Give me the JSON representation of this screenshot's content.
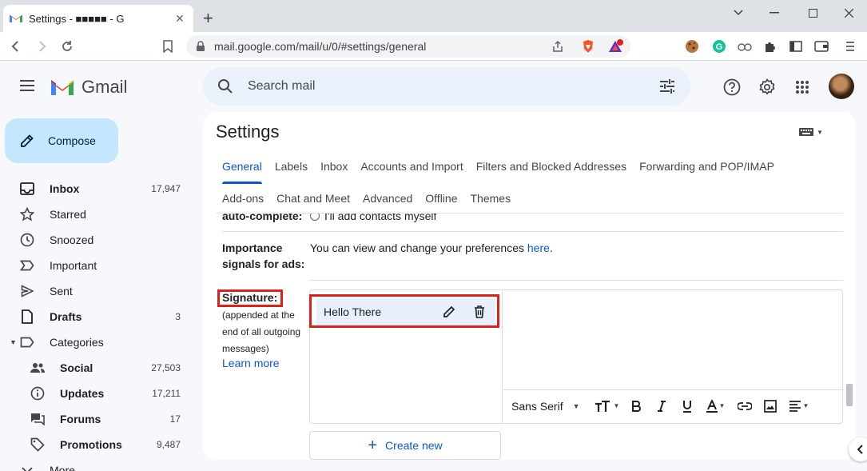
{
  "browser": {
    "tab_title": "Settings - ■■■■■ - G",
    "url": "mail.google.com/mail/u/0/#settings/general",
    "extension_badge": "10"
  },
  "header": {
    "logo_text": "Gmail",
    "search_placeholder": "Search mail"
  },
  "sidebar": {
    "compose_label": "Compose",
    "items": [
      {
        "label": "Inbox",
        "count": "17,947",
        "icon": "inbox-icon"
      },
      {
        "label": "Starred",
        "count": "",
        "icon": "star-icon"
      },
      {
        "label": "Snoozed",
        "count": "",
        "icon": "clock-icon"
      },
      {
        "label": "Important",
        "count": "",
        "icon": "important-icon"
      },
      {
        "label": "Sent",
        "count": "",
        "icon": "send-icon"
      },
      {
        "label": "Drafts",
        "count": "3",
        "icon": "draft-icon"
      },
      {
        "label": "Categories",
        "count": "",
        "icon": "label-icon"
      },
      {
        "label": "Social",
        "count": "27,503",
        "icon": "people-icon"
      },
      {
        "label": "Updates",
        "count": "17,211",
        "icon": "info-icon"
      },
      {
        "label": "Forums",
        "count": "17",
        "icon": "forum-icon"
      },
      {
        "label": "Promotions",
        "count": "9,487",
        "icon": "tag-icon"
      },
      {
        "label": "More",
        "count": "",
        "icon": "chevron-down-icon"
      }
    ]
  },
  "settings": {
    "title": "Settings",
    "tabs_row1": [
      "General",
      "Labels",
      "Inbox",
      "Accounts and Import",
      "Filters and Blocked Addresses",
      "Forwarding and POP/IMAP"
    ],
    "tabs_row2": [
      "Add-ons",
      "Chat and Meet",
      "Advanced",
      "Offline",
      "Themes"
    ],
    "autocomplete_label": "auto-complete:",
    "autocomplete_option": "I'll add contacts myself",
    "importance_label": "Importance signals for ads:",
    "importance_text": "You can view and change your preferences ",
    "importance_link": "here",
    "importance_period": ".",
    "signature_label": "Signature:",
    "signature_sub": "(appended at the end of all outgoing messages)",
    "learn_more": "Learn more",
    "signature_name": "Hello There",
    "font_name": "Sans Serif",
    "create_new": "Create new"
  },
  "colors": {
    "accent": "#0b57d0",
    "highlight": "#e0201c",
    "compose_bg": "#c2e7ff"
  }
}
